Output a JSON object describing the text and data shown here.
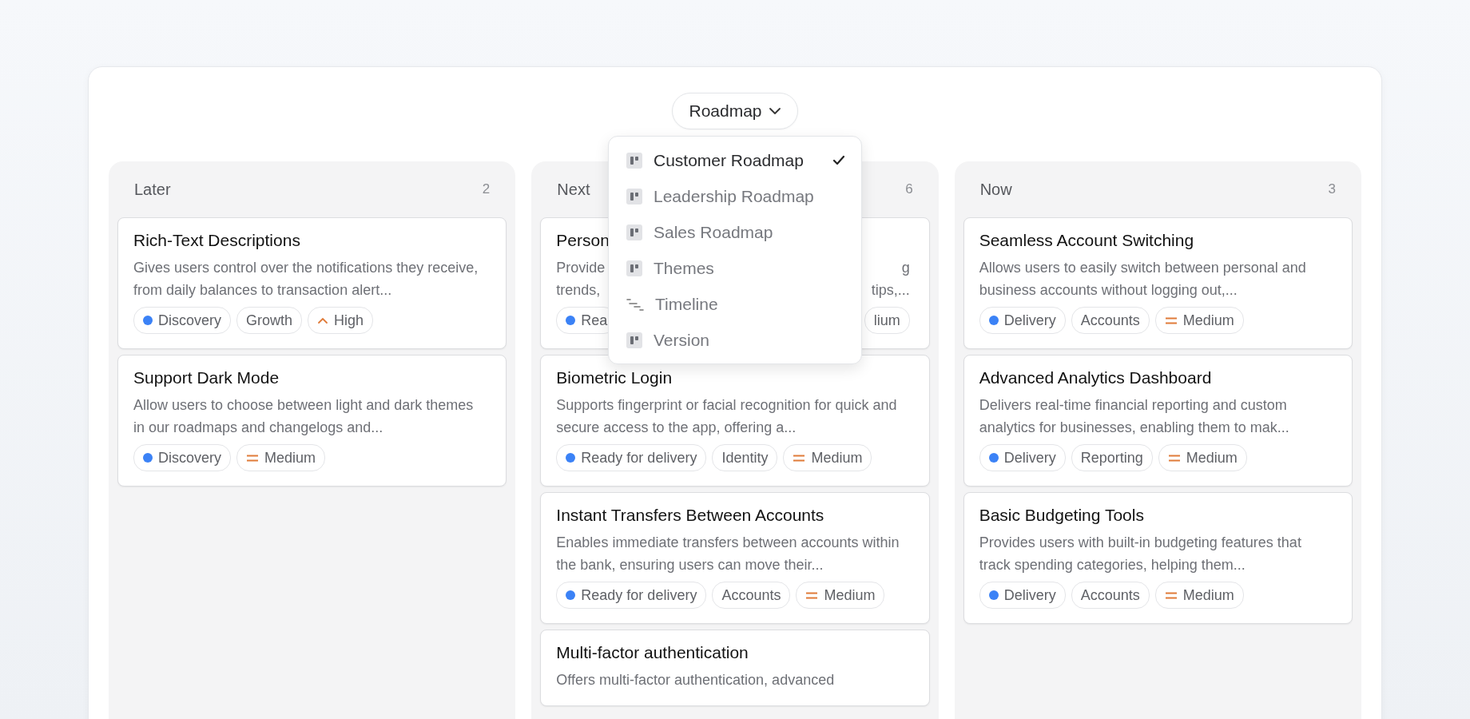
{
  "view_switcher": {
    "label": "Roadmap"
  },
  "menu": [
    {
      "label": "Customer Roadmap",
      "kind": "board",
      "selected": true
    },
    {
      "label": "Leadership Roadmap",
      "kind": "board",
      "selected": false
    },
    {
      "label": "Sales Roadmap",
      "kind": "board",
      "selected": false
    },
    {
      "label": "Themes",
      "kind": "board",
      "selected": false
    },
    {
      "label": "Timeline",
      "kind": "timeline",
      "selected": false
    },
    {
      "label": "Version",
      "kind": "board",
      "selected": false
    }
  ],
  "columns": [
    {
      "title": "Later",
      "count": "2",
      "cards": [
        {
          "kind": "full",
          "title": "Rich-Text Descriptions",
          "description": "Gives users control over the notifications they receive, from daily balances to transaction alert...",
          "tags": [
            {
              "kind": "status",
              "label": "Discovery",
              "color": "#3b82f6"
            },
            {
              "kind": "label",
              "label": "Growth"
            },
            {
              "kind": "priority-high",
              "label": "High"
            }
          ]
        },
        {
          "kind": "full",
          "title": "Support Dark Mode",
          "description": "Allow users to choose between light and dark themes in our roadmaps and changelogs and...",
          "tags": [
            {
              "kind": "status",
              "label": "Discovery",
              "color": "#3b82f6"
            },
            {
              "kind": "priority-medium",
              "label": "Medium"
            }
          ]
        }
      ]
    },
    {
      "title": "Next",
      "count": "6",
      "cards": [
        {
          "kind": "covered",
          "title": "Person",
          "left_lines": [
            "Provide",
            "trends,"
          ],
          "right_lines": [
            "g",
            "tips,..."
          ],
          "tags": [
            {
              "kind": "status",
              "label": "Rea",
              "color": "#3b82f6"
            },
            {
              "kind": "priority",
              "label": "lium"
            }
          ]
        },
        {
          "kind": "full",
          "title": "Biometric Login",
          "description": "Supports fingerprint or facial recognition for quick and secure access to the app, offering a...",
          "tags": [
            {
              "kind": "status",
              "label": "Ready for delivery",
              "color": "#3b82f6"
            },
            {
              "kind": "label",
              "label": "Identity"
            },
            {
              "kind": "priority-medium",
              "label": "Medium"
            }
          ]
        },
        {
          "kind": "full",
          "title": "Instant Transfers Between Accounts",
          "description": "Enables immediate transfers between accounts within the bank, ensuring users can move their...",
          "tags": [
            {
              "kind": "status",
              "label": "Ready for delivery",
              "color": "#3b82f6"
            },
            {
              "kind": "label",
              "label": "Accounts"
            },
            {
              "kind": "priority-medium",
              "label": "Medium"
            }
          ]
        },
        {
          "kind": "full",
          "title": "Multi-factor authentication",
          "description": "Offers multi-factor authentication, advanced"
        }
      ]
    },
    {
      "title": "Now",
      "count": "3",
      "cards": [
        {
          "kind": "full",
          "title": "Seamless Account Switching",
          "description": "Allows users to easily switch between personal and business accounts without logging out,...",
          "tags": [
            {
              "kind": "status",
              "label": "Delivery",
              "color": "#3b82f6"
            },
            {
              "kind": "label",
              "label": "Accounts"
            },
            {
              "kind": "priority-medium",
              "label": "Medium"
            }
          ]
        },
        {
          "kind": "full",
          "title": "Advanced Analytics Dashboard",
          "description": "Delivers real-time financial reporting and custom analytics for businesses, enabling them to mak...",
          "tags": [
            {
              "kind": "status",
              "label": "Delivery",
              "color": "#3b82f6"
            },
            {
              "kind": "label",
              "label": "Reporting"
            },
            {
              "kind": "priority-medium",
              "label": "Medium"
            }
          ]
        },
        {
          "kind": "full",
          "title": "Basic Budgeting Tools",
          "description": "Provides users with built-in budgeting features that track spending categories, helping them...",
          "tags": [
            {
              "kind": "status",
              "label": "Delivery",
              "color": "#3b82f6"
            },
            {
              "kind": "label",
              "label": "Accounts"
            },
            {
              "kind": "priority-medium",
              "label": "Medium"
            }
          ]
        }
      ]
    }
  ]
}
